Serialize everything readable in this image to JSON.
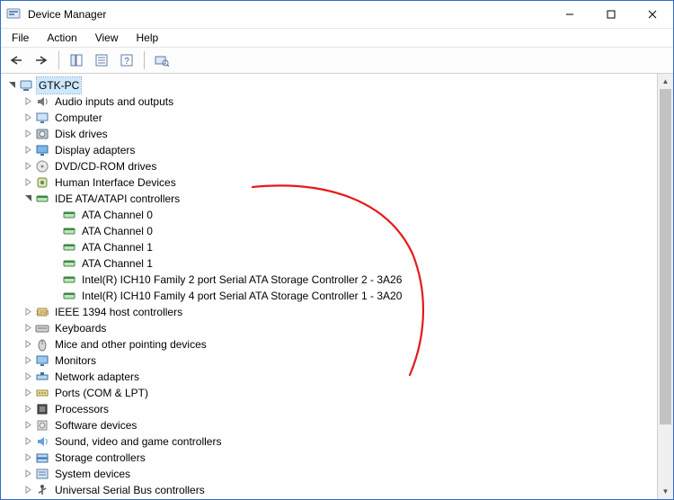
{
  "window": {
    "title": "Device Manager"
  },
  "menubar": [
    "File",
    "Action",
    "View",
    "Help"
  ],
  "tree": {
    "root": {
      "label": "GTK-PC",
      "expanded": true
    },
    "children": [
      {
        "label": "Audio inputs and outputs",
        "icon": "speaker",
        "expanded": false
      },
      {
        "label": "Computer",
        "icon": "monitor",
        "expanded": false
      },
      {
        "label": "Disk drives",
        "icon": "disk",
        "expanded": false
      },
      {
        "label": "Display adapters",
        "icon": "display",
        "expanded": false
      },
      {
        "label": "DVD/CD-ROM drives",
        "icon": "cd",
        "expanded": false
      },
      {
        "label": "Human Interface Devices",
        "icon": "hid",
        "expanded": false
      },
      {
        "label": "IDE ATA/ATAPI controllers",
        "icon": "ide",
        "expanded": true,
        "children": [
          {
            "label": "ATA Channel 0",
            "icon": "ide"
          },
          {
            "label": "ATA Channel 0",
            "icon": "ide"
          },
          {
            "label": "ATA Channel 1",
            "icon": "ide"
          },
          {
            "label": "ATA Channel 1",
            "icon": "ide"
          },
          {
            "label": "Intel(R) ICH10 Family 2 port Serial ATA Storage Controller 2 - 3A26",
            "icon": "ide"
          },
          {
            "label": "Intel(R) ICH10 Family 4 port Serial ATA Storage Controller 1 - 3A20",
            "icon": "ide"
          }
        ]
      },
      {
        "label": "IEEE 1394 host controllers",
        "icon": "firewire",
        "expanded": false
      },
      {
        "label": "Keyboards",
        "icon": "keyboard",
        "expanded": false
      },
      {
        "label": "Mice and other pointing devices",
        "icon": "mouse",
        "expanded": false
      },
      {
        "label": "Monitors",
        "icon": "monitor2",
        "expanded": false
      },
      {
        "label": "Network adapters",
        "icon": "network",
        "expanded": false
      },
      {
        "label": "Ports (COM & LPT)",
        "icon": "port",
        "expanded": false
      },
      {
        "label": "Processors",
        "icon": "cpu",
        "expanded": false
      },
      {
        "label": "Software devices",
        "icon": "software",
        "expanded": false
      },
      {
        "label": "Sound, video and game controllers",
        "icon": "sound",
        "expanded": false
      },
      {
        "label": "Storage controllers",
        "icon": "storage",
        "expanded": false
      },
      {
        "label": "System devices",
        "icon": "system",
        "expanded": false
      },
      {
        "label": "Universal Serial Bus controllers",
        "icon": "usb",
        "expanded": false
      }
    ]
  }
}
